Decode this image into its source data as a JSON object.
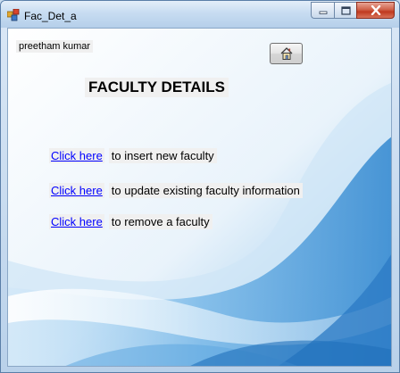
{
  "window": {
    "title": "Fac_Det_a",
    "controls": {
      "minimize": "minimize",
      "maximize": "maximize",
      "close": "close"
    }
  },
  "user": {
    "name": "preetham kumar"
  },
  "home_button": {
    "icon": "home-icon"
  },
  "page": {
    "heading": "FACULTY DETAILS"
  },
  "actions": [
    {
      "link": "Click here",
      "description": "to insert new faculty"
    },
    {
      "link": "Click here",
      "description": "to update existing faculty information"
    },
    {
      "link": "Click here",
      "description": " to  remove a faculty"
    }
  ],
  "colors": {
    "link": "#0000ff",
    "label_background": "#f0f0f0",
    "accent_blue": "#4a9ad6"
  }
}
